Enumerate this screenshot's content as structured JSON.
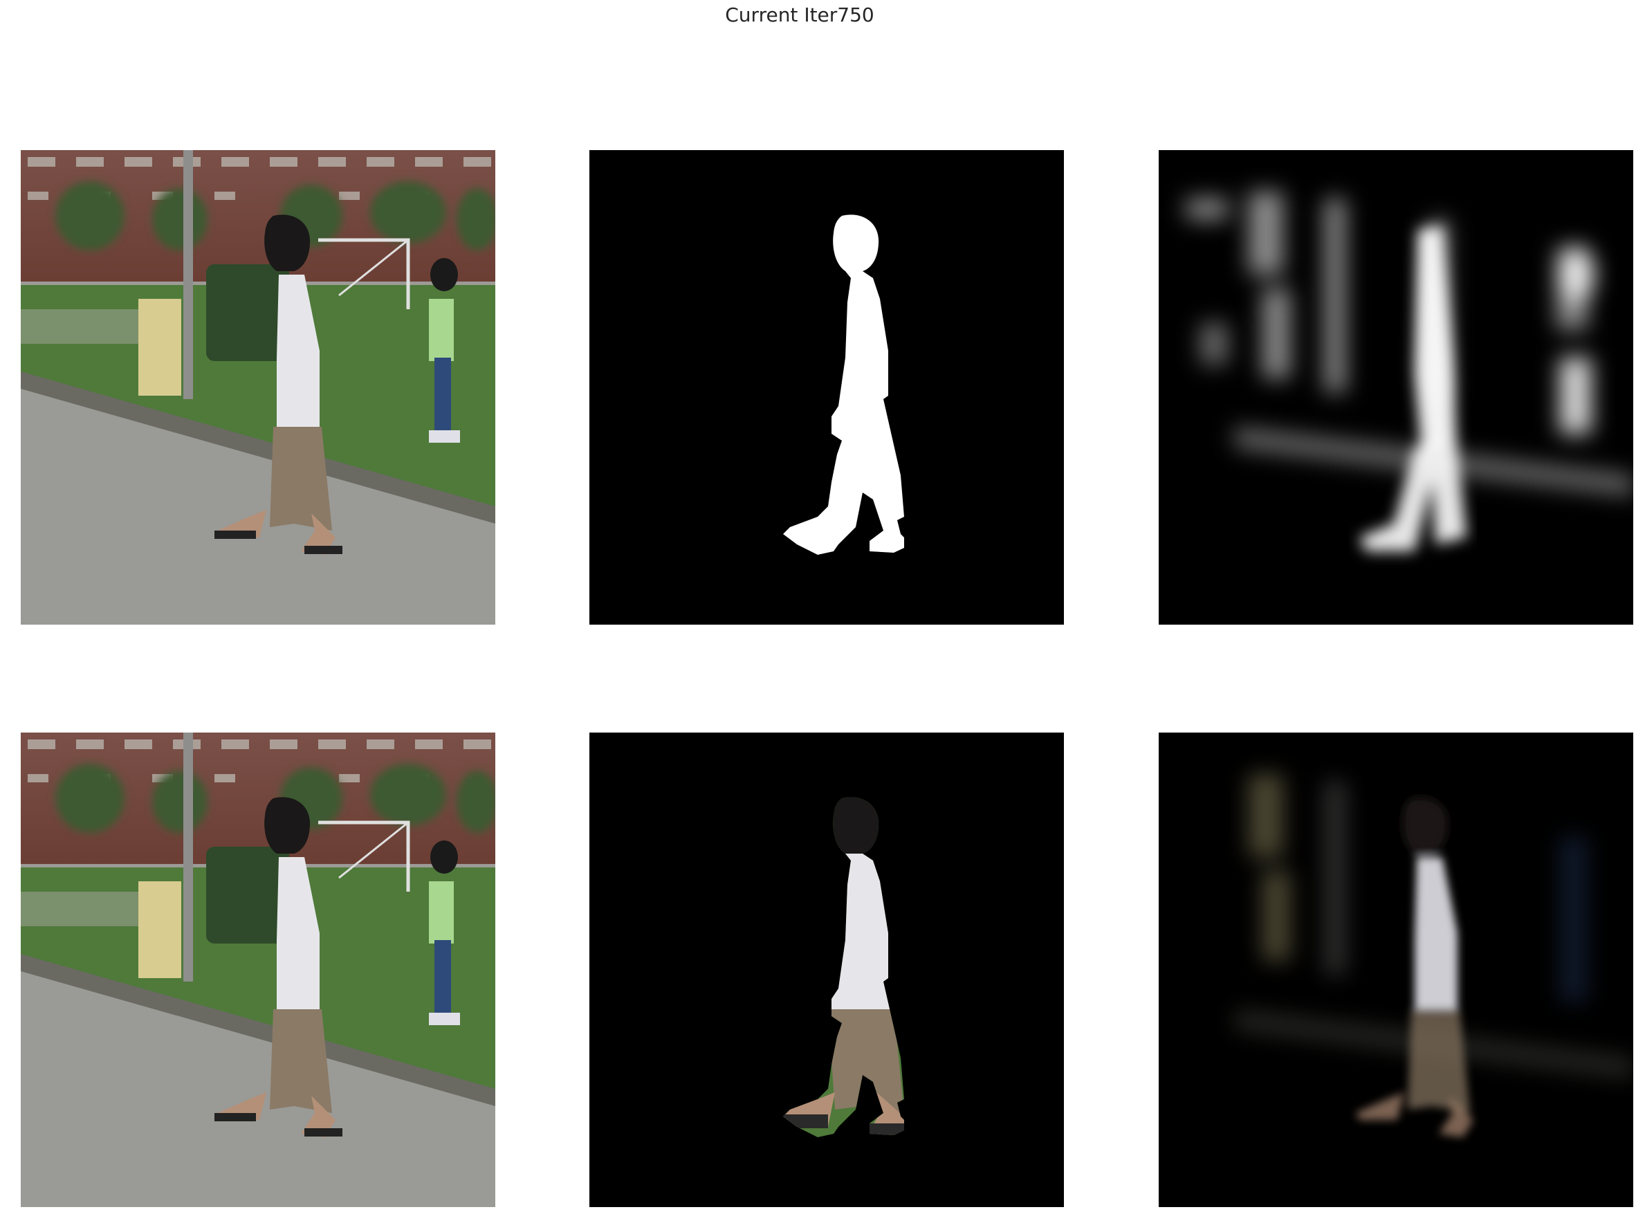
{
  "figure": {
    "title": "Current Iter750"
  },
  "panels": [
    {
      "row": 1,
      "col": 1,
      "content": "input-photo"
    },
    {
      "row": 1,
      "col": 2,
      "content": "ground-truth-mask"
    },
    {
      "row": 1,
      "col": 3,
      "content": "predicted-mask"
    },
    {
      "row": 2,
      "col": 1,
      "content": "input-photo"
    },
    {
      "row": 2,
      "col": 2,
      "content": "ground-truth-masked-photo"
    },
    {
      "row": 2,
      "col": 3,
      "content": "predicted-masked-photo"
    }
  ],
  "colors": {
    "background": "#ffffff",
    "mask_background": "#000000",
    "mask_foreground": "#ffffff",
    "building_brick": "#8a4a3c",
    "grass": "#4f7a3a",
    "road": "#9a9a96",
    "shirt": "#e6e6ea",
    "shorts": "#8a7a66",
    "hedge": "#2e4a2a",
    "post": "#d8cc90"
  }
}
